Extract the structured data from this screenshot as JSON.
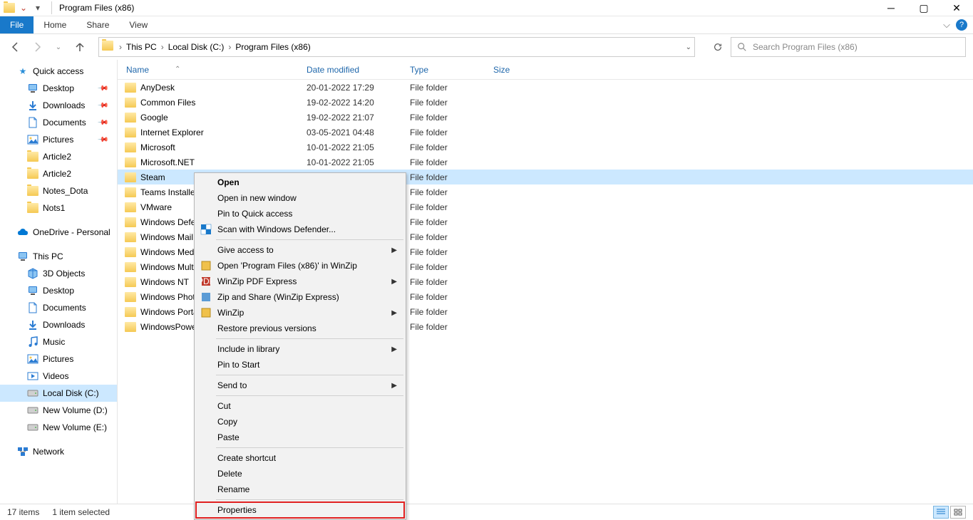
{
  "window": {
    "title": "Program Files (x86)"
  },
  "ribbon": {
    "file": "File",
    "home": "Home",
    "share": "Share",
    "view": "View"
  },
  "breadcrumb": {
    "items": [
      "This PC",
      "Local Disk (C:)",
      "Program Files (x86)"
    ]
  },
  "search": {
    "placeholder": "Search Program Files (x86)"
  },
  "sidebar": {
    "quick_access": "Quick access",
    "quick_items": [
      {
        "label": "Desktop",
        "pinned": true,
        "icon": "desktop"
      },
      {
        "label": "Downloads",
        "pinned": true,
        "icon": "downloads"
      },
      {
        "label": "Documents",
        "pinned": true,
        "icon": "documents"
      },
      {
        "label": "Pictures",
        "pinned": true,
        "icon": "pictures"
      },
      {
        "label": "Article2",
        "pinned": false,
        "icon": "folder"
      },
      {
        "label": "Article2",
        "pinned": false,
        "icon": "folder"
      },
      {
        "label": "Notes_Dota",
        "pinned": false,
        "icon": "folder"
      },
      {
        "label": "Nots1",
        "pinned": false,
        "icon": "folder"
      }
    ],
    "onedrive": "OneDrive - Personal",
    "this_pc": "This PC",
    "pc_items": [
      {
        "label": "3D Objects",
        "icon": "3d"
      },
      {
        "label": "Desktop",
        "icon": "desktop"
      },
      {
        "label": "Documents",
        "icon": "documents"
      },
      {
        "label": "Downloads",
        "icon": "downloads"
      },
      {
        "label": "Music",
        "icon": "music"
      },
      {
        "label": "Pictures",
        "icon": "pictures"
      },
      {
        "label": "Videos",
        "icon": "videos"
      },
      {
        "label": "Local Disk (C:)",
        "icon": "disk",
        "selected": true
      },
      {
        "label": "New Volume (D:)",
        "icon": "disk"
      },
      {
        "label": "New Volume (E:)",
        "icon": "disk"
      }
    ],
    "network": "Network"
  },
  "columns": {
    "name": "Name",
    "date": "Date modified",
    "type": "Type",
    "size": "Size"
  },
  "files": [
    {
      "name": "AnyDesk",
      "date": "20-01-2022 17:29",
      "type": "File folder"
    },
    {
      "name": "Common Files",
      "date": "19-02-2022 14:20",
      "type": "File folder"
    },
    {
      "name": "Google",
      "date": "19-02-2022 21:07",
      "type": "File folder"
    },
    {
      "name": "Internet Explorer",
      "date": "03-05-2021 04:48",
      "type": "File folder"
    },
    {
      "name": "Microsoft",
      "date": "10-01-2022 21:05",
      "type": "File folder"
    },
    {
      "name": "Microsoft.NET",
      "date": "10-01-2022 21:05",
      "type": "File folder"
    },
    {
      "name": "Steam",
      "date": "",
      "type": "File folder",
      "selected": true
    },
    {
      "name": "Teams Installer",
      "date": "",
      "type": "File folder"
    },
    {
      "name": "VMware",
      "date": "",
      "type": "File folder"
    },
    {
      "name": "Windows Defender",
      "date": "",
      "type": "File folder"
    },
    {
      "name": "Windows Mail",
      "date": "",
      "type": "File folder"
    },
    {
      "name": "Windows Media Player",
      "date": "",
      "type": "File folder"
    },
    {
      "name": "Windows Multimedia Platform",
      "date": "",
      "type": "File folder"
    },
    {
      "name": "Windows NT",
      "date": "",
      "type": "File folder"
    },
    {
      "name": "Windows Photo Viewer",
      "date": "",
      "type": "File folder"
    },
    {
      "name": "Windows Portable Devices",
      "date": "",
      "type": "File folder"
    },
    {
      "name": "WindowsPowerShell",
      "date": "",
      "type": "File folder"
    }
  ],
  "context_menu": {
    "open": "Open",
    "open_new": "Open in new window",
    "pin_quick": "Pin to Quick access",
    "scan_defender": "Scan with Windows Defender...",
    "give_access": "Give access to",
    "open_winzip": "Open 'Program Files (x86)' in WinZip",
    "winzip_pdf": "WinZip PDF Express",
    "zip_share": "Zip and Share (WinZip Express)",
    "winzip": "WinZip",
    "restore": "Restore previous versions",
    "include_library": "Include in library",
    "pin_start": "Pin to Start",
    "send_to": "Send to",
    "cut": "Cut",
    "copy": "Copy",
    "paste": "Paste",
    "create_shortcut": "Create shortcut",
    "delete": "Delete",
    "rename": "Rename",
    "properties": "Properties"
  },
  "statusbar": {
    "count": "17 items",
    "selected": "1 item selected"
  }
}
